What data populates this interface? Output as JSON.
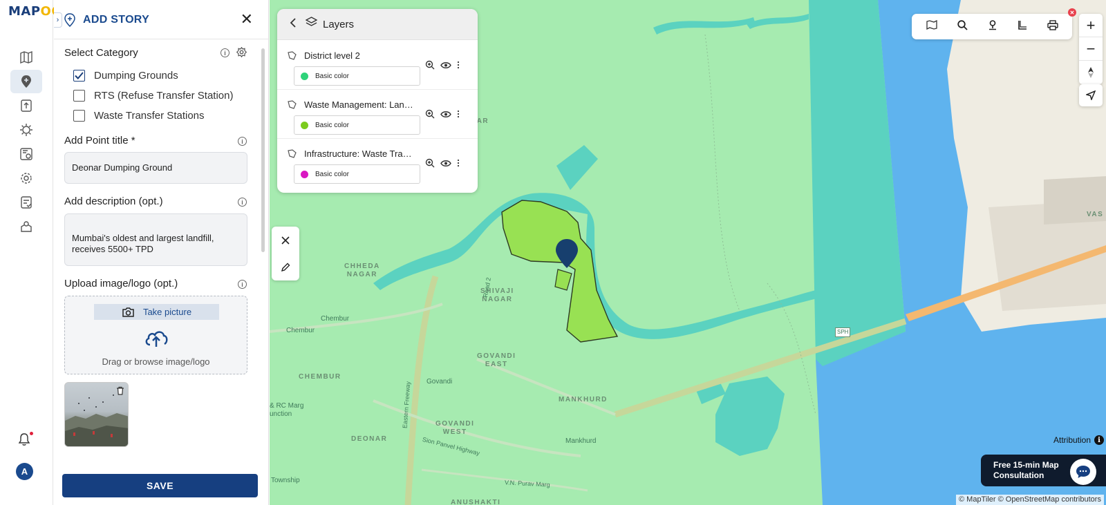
{
  "app": {
    "logo_prefix": "MAP",
    "logo_suffix": "OG"
  },
  "panel": {
    "title": "ADD STORY",
    "category_label": "Select Category",
    "categories": [
      {
        "label": "Dumping Grounds",
        "checked": true
      },
      {
        "label": "RTS (Refuse Transfer Station)",
        "checked": false
      },
      {
        "label": "Waste Transfer Stations",
        "checked": false
      }
    ],
    "point_title_label": "Add Point title *",
    "point_title_value": "Deonar Dumping Ground",
    "description_label": "Add description (opt.)",
    "description_value": "Mumbai's oldest and largest landfill, receives 5500+ TPD",
    "upload_label": "Upload image/logo (opt.)",
    "take_picture": "Take picture",
    "drag_text": "Drag or browse image/logo",
    "save_label": "SAVE"
  },
  "rail": {
    "avatar_initial": "A"
  },
  "layers": {
    "title": "Layers",
    "items": [
      {
        "name": "District level 2",
        "color_label": "Basic color",
        "color": "#2fd37a"
      },
      {
        "name": "Waste Management: Landfill",
        "color_label": "Basic color",
        "color": "#7ccb1e"
      },
      {
        "name": "Infrastructure: Waste Transfer",
        "color_label": "Basic color",
        "color": "#d918c2"
      }
    ]
  },
  "map": {
    "labels": {
      "chheda_nagar": "CHHEDA\nNAGAR",
      "shivaji_nagar": "SHIVAJI\nNAGAR",
      "govandi_east": "GOVANDI\nEAST",
      "govandi_west": "GOVANDI\nWEST",
      "chembur_big": "CHEMBUR",
      "chembur_small_1": "Chembur",
      "chembur_small_2": "Chembur",
      "govandi_station": "Govandi",
      "mankhurd_big": "MANKHURD",
      "mankhurd_station": "Mankhurd",
      "deonar": "DEONAR",
      "opar": "OPAR",
      "vas": "VAS",
      "road_2": "Road 2",
      "eastern_freeway": "Eastern Freeway",
      "sion_panvel": "Sion Panvel Highway",
      "vn_purav": "V.N. Purav Marg",
      "rc_marg": "& RC Marg\nunction",
      "township": "Township",
      "anushakti": "ANUSHAKTI",
      "sph": "SPH"
    },
    "attribution": "Attribution",
    "consult_text": "Free 15-min Map\nConsultation",
    "copyright": "© MapTiler © OpenStreetMap contributors",
    "colors": {
      "land": "#a6ebb0",
      "water": "#5bd2c0",
      "sea": "#5fb3ee",
      "landfill": "#98e153",
      "marker": "#173f6e"
    }
  }
}
